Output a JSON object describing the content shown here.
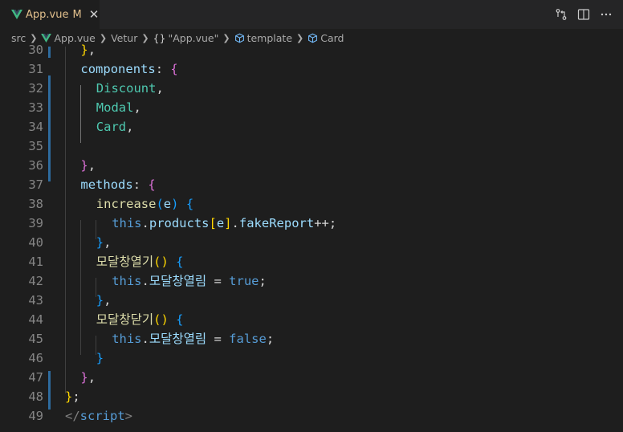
{
  "tab": {
    "filename": "App.vue",
    "modified": "M",
    "close": "✕"
  },
  "breadcrumb": {
    "items": [
      "src",
      "App.vue",
      "Vetur",
      "\"App.vue\"",
      "template",
      "Card"
    ]
  },
  "lines": [
    {
      "n": "30",
      "indent": 1,
      "tokens": [
        [
          "y",
          "}"
        ],
        [
          "w",
          ","
        ]
      ]
    },
    {
      "n": "31",
      "indent": 1,
      "tokens": [
        [
          "k",
          "components"
        ],
        [
          "w",
          ": "
        ],
        [
          "m",
          "{"
        ]
      ]
    },
    {
      "n": "32",
      "indent": 2,
      "tokens": [
        [
          "t",
          "Discount"
        ],
        [
          "w",
          ","
        ]
      ]
    },
    {
      "n": "33",
      "indent": 2,
      "tokens": [
        [
          "t",
          "Modal"
        ],
        [
          "w",
          ","
        ]
      ]
    },
    {
      "n": "34",
      "indent": 2,
      "tokens": [
        [
          "t",
          "Card"
        ],
        [
          "w",
          ","
        ]
      ]
    },
    {
      "n": "35",
      "indent": 2,
      "tokens": []
    },
    {
      "n": "36",
      "indent": 1,
      "tokens": [
        [
          "m",
          "}"
        ],
        [
          "w",
          ","
        ]
      ]
    },
    {
      "n": "37",
      "indent": 1,
      "tokens": [
        [
          "k",
          "methods"
        ],
        [
          "w",
          ": "
        ],
        [
          "m",
          "{"
        ]
      ]
    },
    {
      "n": "38",
      "indent": 2,
      "tokens": [
        [
          "f",
          "increase"
        ],
        [
          "bl",
          "("
        ],
        [
          "p",
          "e"
        ],
        [
          "bl",
          ")"
        ],
        [
          "w",
          " "
        ],
        [
          "bl",
          "{"
        ]
      ]
    },
    {
      "n": "39",
      "indent": 3,
      "tokens": [
        [
          "b",
          "this"
        ],
        [
          "w",
          "."
        ],
        [
          "k",
          "products"
        ],
        [
          "y",
          "["
        ],
        [
          "p",
          "e"
        ],
        [
          "y",
          "]"
        ],
        [
          "w",
          "."
        ],
        [
          "k",
          "fakeReport"
        ],
        [
          "w",
          "++;"
        ]
      ]
    },
    {
      "n": "40",
      "indent": 2,
      "tokens": [
        [
          "bl",
          "}"
        ],
        [
          "w",
          ","
        ]
      ]
    },
    {
      "n": "41",
      "indent": 2,
      "tokens": [
        [
          "f",
          "모달창열기"
        ],
        [
          "y",
          "()"
        ],
        [
          "w",
          " "
        ],
        [
          "bl",
          "{"
        ]
      ]
    },
    {
      "n": "42",
      "indent": 3,
      "tokens": [
        [
          "b",
          "this"
        ],
        [
          "w",
          "."
        ],
        [
          "k",
          "모달창열림"
        ],
        [
          "w",
          " = "
        ],
        [
          "b",
          "true"
        ],
        [
          "w",
          ";"
        ]
      ]
    },
    {
      "n": "43",
      "indent": 2,
      "tokens": [
        [
          "bl",
          "}"
        ],
        [
          "w",
          ","
        ]
      ]
    },
    {
      "n": "44",
      "indent": 2,
      "tokens": [
        [
          "f",
          "모달창닫기"
        ],
        [
          "y",
          "()"
        ],
        [
          "w",
          " "
        ],
        [
          "bl",
          "{"
        ]
      ]
    },
    {
      "n": "45",
      "indent": 3,
      "tokens": [
        [
          "b",
          "this"
        ],
        [
          "w",
          "."
        ],
        [
          "k",
          "모달창열림"
        ],
        [
          "w",
          " = "
        ],
        [
          "b",
          "false"
        ],
        [
          "w",
          ";"
        ]
      ]
    },
    {
      "n": "46",
      "indent": 2,
      "tokens": [
        [
          "bl",
          "}"
        ]
      ]
    },
    {
      "n": "47",
      "indent": 1,
      "tokens": [
        [
          "m",
          "}"
        ],
        [
          "w",
          ","
        ]
      ]
    },
    {
      "n": "48",
      "indent": 0,
      "tokens": [
        [
          "y",
          "}"
        ],
        [
          "w",
          ";"
        ]
      ]
    },
    {
      "n": "49",
      "indent": 0,
      "tokens": [
        [
          "tag",
          "</"
        ],
        [
          "tagname",
          "script"
        ],
        [
          "tag",
          ">"
        ]
      ]
    }
  ],
  "colors": {
    "accent_modified": "#e2c08d",
    "vue_green": "#41b883",
    "editor_bg": "#1e1e1e"
  }
}
